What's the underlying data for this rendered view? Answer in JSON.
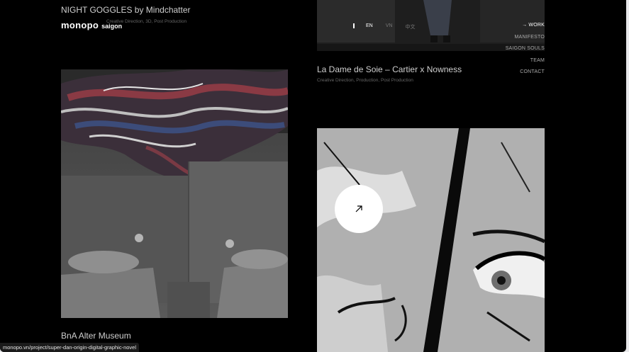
{
  "header": {
    "logo_main": "monopo",
    "logo_sub": "saigon"
  },
  "languages": [
    {
      "label": "EN",
      "active": true
    },
    {
      "label": "VN",
      "active": false
    },
    {
      "label": "中文",
      "active": false
    }
  ],
  "nav": [
    {
      "label": "→ WORK",
      "active": true
    },
    {
      "label": "MANIFESTO",
      "active": false
    },
    {
      "label": "SAIGON SOULS",
      "active": false
    },
    {
      "label": "TEAM",
      "active": false
    },
    {
      "label": "CONTACT",
      "active": false
    }
  ],
  "projects": [
    {
      "title": "NIGHT GOGGLES by Mindchatter",
      "subtitle": "Creative Direction, 3D, Post Production"
    },
    {
      "title": "La Dame de Soie – Cartier x Nowness",
      "subtitle": "Creative Direction, Production, Post Production"
    },
    {
      "title": "BnA Alter Museum",
      "subtitle": ""
    }
  ],
  "status_url": "monopo.vn/project/super-dan-origin-digital-graphic-novel",
  "colors": {
    "background": "#000000",
    "text": "#ffffff",
    "muted": "#777777"
  }
}
